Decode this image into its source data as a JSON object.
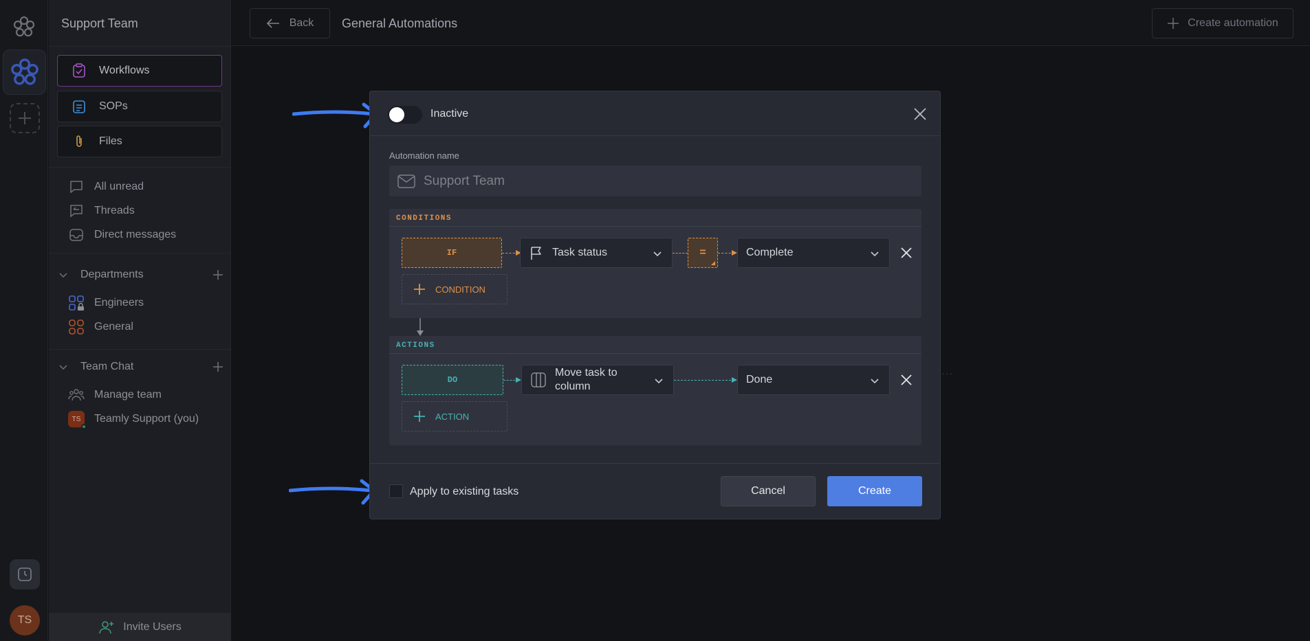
{
  "workspace": {
    "name": "Support Team"
  },
  "sidebar": {
    "cards": [
      {
        "label": "Workflows",
        "icon": "clipboard-check-icon",
        "color": "#a656c8"
      },
      {
        "label": "SOPs",
        "icon": "list-clipboard-icon",
        "color": "#3f8ed8"
      },
      {
        "label": "Files",
        "icon": "paperclip-icon",
        "color": "#c99a3b"
      }
    ],
    "items": [
      {
        "label": "All unread",
        "icon": "chat-bubble-icon"
      },
      {
        "label": "Threads",
        "icon": "threads-icon"
      },
      {
        "label": "Direct messages",
        "icon": "inbox-icon"
      }
    ],
    "departments": {
      "label": "Departments",
      "items": [
        {
          "label": "Engineers",
          "icon": "grid-lock-icon",
          "color": "#4768c9"
        },
        {
          "label": "General",
          "icon": "grid-icon",
          "color": "#b5532c"
        }
      ]
    },
    "team_chat": {
      "label": "Team Chat",
      "items": [
        {
          "label": "Manage team",
          "icon": "people-icon"
        },
        {
          "label": "Teamly Support (you)",
          "avatar": "TS"
        }
      ]
    },
    "invite_label": "Invite Users"
  },
  "rail": {
    "avatar": "TS"
  },
  "topbar": {
    "back_label": "Back",
    "title": "General Automations",
    "create_label": "Create automation"
  },
  "modal": {
    "status_label": "Inactive",
    "name_label": "Automation name",
    "name_placeholder": "Support Team",
    "conditions": {
      "title": "CONDITIONS",
      "chip": "IF",
      "field": "Task status",
      "operator": "=",
      "value": "Complete",
      "add_label": "CONDITION"
    },
    "actions": {
      "title": "ACTIONS",
      "chip": "DO",
      "action": "Move task to column",
      "target": "Done",
      "add_label": "ACTION"
    },
    "apply_label": "Apply to existing tasks",
    "cancel_label": "Cancel",
    "create_label": "Create"
  },
  "colors": {
    "condition_accent": "#e0914a",
    "action_accent": "#46b3b5",
    "primary": "#4f7ee3",
    "annotation_arrow": "#3f7bf2"
  }
}
